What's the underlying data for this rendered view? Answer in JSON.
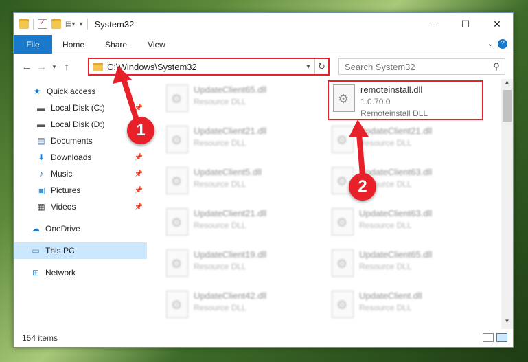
{
  "window": {
    "title": "System32",
    "controls": {
      "minimize": "—",
      "maximize": "☐",
      "close": "✕"
    }
  },
  "ribbon": {
    "tabs": [
      "File",
      "Home",
      "Share",
      "View"
    ],
    "help": "?"
  },
  "address": {
    "path": "C:\\Windows\\System32",
    "search_placeholder": "Search System32"
  },
  "sidebar": {
    "items": [
      {
        "label": "Quick access",
        "icon": "star-icon",
        "pinned": false
      },
      {
        "label": "Local Disk (C:)",
        "icon": "drive-icon",
        "pinned": true
      },
      {
        "label": "Local Disk (D:)",
        "icon": "drive-icon",
        "pinned": false
      },
      {
        "label": "Documents",
        "icon": "documents-icon",
        "pinned": true
      },
      {
        "label": "Downloads",
        "icon": "download-icon",
        "pinned": true
      },
      {
        "label": "Music",
        "icon": "music-icon",
        "pinned": true
      },
      {
        "label": "Pictures",
        "icon": "pictures-icon",
        "pinned": true
      },
      {
        "label": "Videos",
        "icon": "videos-icon",
        "pinned": true
      },
      {
        "label": "OneDrive",
        "icon": "cloud-icon",
        "pinned": false
      },
      {
        "label": "This PC",
        "icon": "pc-icon",
        "pinned": false,
        "selected": true
      },
      {
        "label": "Network",
        "icon": "network-icon",
        "pinned": false
      }
    ]
  },
  "files": {
    "left_column": [
      {
        "name": "UpdateClient65.dll",
        "type": "Resource DLL"
      },
      {
        "name": "UpdateClient21.dll",
        "type": "Resource DLL"
      },
      {
        "name": "UpdateClient5.dll",
        "type": "Resource DLL"
      },
      {
        "name": "UpdateClient21.dll",
        "type": "Resource DLL"
      },
      {
        "name": "UpdateClient19.dll",
        "type": "Resource DLL"
      },
      {
        "name": "UpdateClient42.dll",
        "type": "Resource DLL"
      }
    ],
    "right_column": [
      {
        "name": "UpdateClient21.dll",
        "type": "Resource DLL"
      },
      {
        "name": "UpdateClient63.dll",
        "type": "Resource DLL"
      },
      {
        "name": "UpdateClient63.dll",
        "type": "Resource DLL"
      },
      {
        "name": "UpdateClient65.dll",
        "type": "Resource DLL"
      },
      {
        "name": "UpdateClient.dll",
        "type": "Resource DLL"
      }
    ],
    "highlighted": {
      "name": "remoteinstall.dll",
      "version": "1.0.70.0",
      "description": "Remoteinstall DLL"
    }
  },
  "status": {
    "count": "154 items"
  },
  "callouts": {
    "one": "1",
    "two": "2"
  },
  "colors": {
    "accent": "#1979ca",
    "callout": "#e8202a",
    "selected": "#cce8ff"
  }
}
